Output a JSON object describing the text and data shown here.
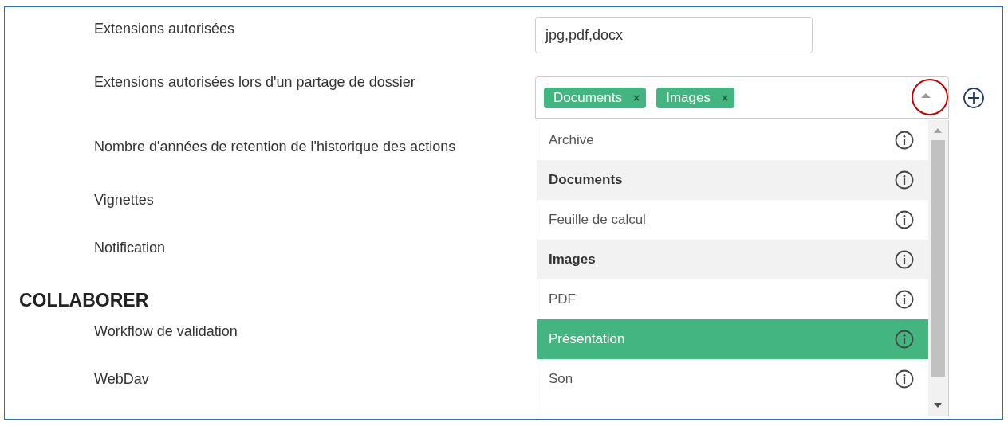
{
  "settings": [
    {
      "kind": "label",
      "text": "Extensions autorisées"
    },
    {
      "kind": "label",
      "text": "Extensions autorisées lors d'un partage de dossier"
    },
    {
      "kind": "label",
      "text": "Nombre d'années de retention de l'historique des actions"
    },
    {
      "kind": "label",
      "text": "Vignettes"
    },
    {
      "kind": "label",
      "text": "Notification"
    },
    {
      "kind": "heading",
      "text": "COLLABORER"
    },
    {
      "kind": "label",
      "text": "Workflow de validation"
    },
    {
      "kind": "label",
      "text": "WebDav"
    }
  ],
  "extensions_field": {
    "value": "jpg,pdf,docx"
  },
  "folder_share_select": {
    "expanded": true,
    "tags": [
      {
        "label": "Documents",
        "remove": "×"
      },
      {
        "label": "Images",
        "remove": "×"
      }
    ],
    "options": [
      {
        "label": "Archive",
        "selected": false,
        "highlighted": false
      },
      {
        "label": "Documents",
        "selected": true,
        "highlighted": false
      },
      {
        "label": "Feuille de calcul",
        "selected": false,
        "highlighted": false
      },
      {
        "label": "Images",
        "selected": true,
        "highlighted": false
      },
      {
        "label": "PDF",
        "selected": false,
        "highlighted": false
      },
      {
        "label": "Présentation",
        "selected": false,
        "highlighted": true
      },
      {
        "label": "Son",
        "selected": false,
        "highlighted": false
      }
    ]
  }
}
